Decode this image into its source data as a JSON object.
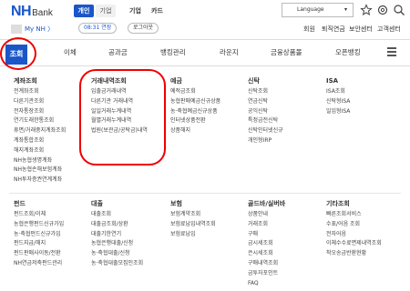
{
  "header": {
    "logo": "NH",
    "logo_suffix": "Bank",
    "segments": [
      "개인",
      "기업"
    ],
    "extra_nav": [
      "기업",
      "카드"
    ],
    "language": "Language",
    "icons": [
      "star-icon",
      "settings-icon",
      "search-icon"
    ]
  },
  "userbar": {
    "user": "My NH",
    "user_suffix": "〉",
    "time": "08:31 연장",
    "logout": "로그아웃",
    "links": [
      "회원",
      "퇴직연금",
      "보안센터",
      "고객센터"
    ]
  },
  "menu": {
    "tabs": [
      "조회",
      "이체",
      "공과금",
      "뱅킹관리",
      "라운지",
      "금융상품몰",
      "오픈뱅킹"
    ]
  },
  "sections_top": [
    {
      "title": "계좌조회",
      "items": [
        "전계좌조회",
        "다른기관조회",
        "전자통장조회",
        "연기도래한통조회",
        "휴면/거래중지계좌조회",
        "계좌통합조회",
        "해지계좌조회",
        "NH농협생명계좌",
        "NH농협손해보험계좌",
        "NH투자증권연계계좌"
      ]
    },
    {
      "title": "거래내역조회",
      "items": [
        "입출금거래내역",
        "다른기관 거래내역",
        "일일거래누계내역",
        "월별거래누계내역",
        "법원(보관금/공탁금)내역"
      ]
    },
    {
      "title": "예금",
      "items": [
        "예적금조회",
        "농협판매예금신규상품",
        "농·축협예금신규상품",
        "인터넷상품전환",
        "상품해지"
      ]
    },
    {
      "title": "신탁",
      "items": [
        "신탁조회",
        "연금신탁",
        "공익신탁",
        "특정금전신탁",
        "신탁인터넷신규",
        "개인형IRP"
      ]
    },
    {
      "title": "ISA",
      "items": [
        "ISA조회",
        "신탁형ISA",
        "일임형ISA"
      ]
    }
  ],
  "sections_bottom": [
    {
      "title": "펀드",
      "items": [
        "펀드조회/이체",
        "농협은행펀드신규가입",
        "농·축협펀드신규가입",
        "펀드지급/해지",
        "펀드판매사이동/전환",
        "NH연금저축펀드관리"
      ]
    },
    {
      "title": "대출",
      "items": [
        "대출조회",
        "대출금조회/상환",
        "대출기한연기",
        "농협은행대출/신청",
        "농·축협대출/신청",
        "농·축협대출모집인조회"
      ]
    },
    {
      "title": "보험",
      "items": [
        "보험계약조회",
        "보험료납입내역조회",
        "보험료납입"
      ]
    },
    {
      "title": "골드바/실버바",
      "items": [
        "상품안내",
        "거래조회",
        "구매",
        "금시세조회",
        "은시세조회",
        "구매내역조회",
        "금투자포인트",
        "FAQ"
      ]
    },
    {
      "title": "기타조회",
      "items": [
        "빠른조회서비스",
        "수표/어음 조회",
        "전자어음",
        "이체수수료면제내역조회",
        "착오송금반환현황"
      ]
    }
  ]
}
